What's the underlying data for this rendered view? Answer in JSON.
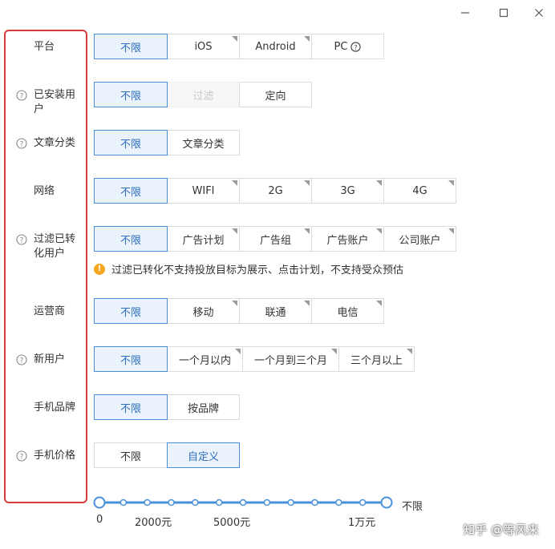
{
  "colors": {
    "accent": "#4a90d9",
    "highlight_border": "#d83b3b",
    "warning": "#f5a623"
  },
  "window": {
    "controls": [
      "minimize-icon",
      "maximize-icon",
      "close-icon"
    ]
  },
  "rows": {
    "platform": {
      "label": "平台",
      "options": [
        "不限",
        "iOS",
        "Android",
        "PC"
      ]
    },
    "installed": {
      "label_line1": "已安装用",
      "label_line2": "户",
      "options": [
        "不限",
        "过滤",
        "定向"
      ]
    },
    "category": {
      "label": "文章分类",
      "options": [
        "不限",
        "文章分类"
      ]
    },
    "network": {
      "label": "网络",
      "options": [
        "不限",
        "WIFI",
        "2G",
        "3G",
        "4G"
      ]
    },
    "converted": {
      "label_line1": "过滤已转",
      "label_line2": "化用户",
      "options": [
        "不限",
        "广告计划",
        "广告组",
        "广告账户",
        "公司账户"
      ],
      "warning": "过滤已转化不支持投放目标为展示、点击计划，不支持受众预估"
    },
    "carrier": {
      "label": "运营商",
      "options": [
        "不限",
        "移动",
        "联通",
        "电信"
      ]
    },
    "new_user": {
      "label": "新用户",
      "options": [
        "不限",
        "一个月以内",
        "一个月到三个月",
        "三个月以上"
      ]
    },
    "brand": {
      "label": "手机品牌",
      "options": [
        "不限",
        "按品牌"
      ]
    },
    "price": {
      "label": "手机价格",
      "options": [
        "不限",
        "自定义"
      ]
    }
  },
  "price_slider": {
    "tick_labels": [
      "0",
      "2000元",
      "5000元",
      "1万元"
    ],
    "end_label": "不限",
    "stop_count": 13,
    "selected_start": 0,
    "selected_end": 12
  },
  "watermark": "知乎 @等风来"
}
